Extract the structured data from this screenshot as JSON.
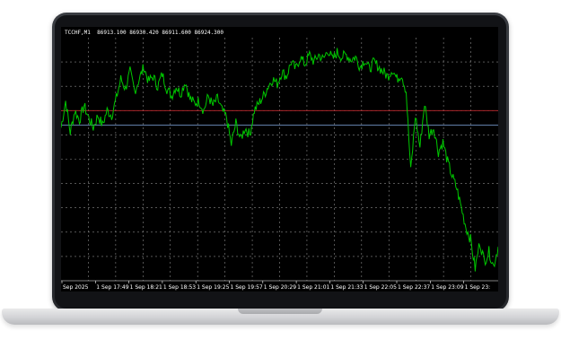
{
  "window": {
    "header": "TCCHF,M1  86913.100 86930.420 86911.600 86924.300"
  },
  "chart_data": {
    "type": "line",
    "symbol": "TCCHF,M1",
    "ohlc": {
      "open": 86913.1,
      "high": 86930.42,
      "low": 86911.6,
      "close": 86924.3
    },
    "background": "#000000",
    "line_color": "#00c800",
    "grid": true,
    "grid_color": "#8a8a8a",
    "bid_line_color": "#c0282d",
    "ask_line_color": "#6f8fbf",
    "x_tick_labels": [
      "Sep 2025",
      "1 Sep 17:49",
      "1 Sep 18:21",
      "1 Sep 18:53",
      "1 Sep 19:25",
      "1 Sep 19:57",
      "1 Sep 20:29",
      "1 Sep 21:01",
      "1 Sep 21:33",
      "1 Sep 22:05",
      "1 Sep 22:37",
      "1 Sep 23:09",
      "1 Sep 23:"
    ],
    "y": {
      "min": 0,
      "max": 100
    },
    "bid_level": 70,
    "ask_level": 64,
    "points": [
      [
        0,
        63
      ],
      [
        1,
        74
      ],
      [
        2,
        61
      ],
      [
        3,
        70
      ],
      [
        4,
        66
      ],
      [
        5,
        72
      ],
      [
        6,
        67
      ],
      [
        7,
        63
      ],
      [
        8,
        68
      ],
      [
        9,
        64
      ],
      [
        10,
        70
      ],
      [
        11,
        68
      ],
      [
        12,
        75
      ],
      [
        13,
        83
      ],
      [
        14,
        79
      ],
      [
        15,
        86
      ],
      [
        16,
        78
      ],
      [
        17,
        83
      ],
      [
        18,
        88
      ],
      [
        19,
        82
      ],
      [
        20,
        84
      ],
      [
        21,
        80
      ],
      [
        22,
        85
      ],
      [
        23,
        79
      ],
      [
        24,
        76
      ],
      [
        25,
        80
      ],
      [
        26,
        77
      ],
      [
        27,
        82
      ],
      [
        28,
        75
      ],
      [
        29,
        73
      ],
      [
        30,
        74
      ],
      [
        31,
        70
      ],
      [
        32,
        76
      ],
      [
        33,
        72
      ],
      [
        34,
        75
      ],
      [
        35,
        70
      ],
      [
        36,
        67
      ],
      [
        37,
        56
      ],
      [
        38,
        65
      ],
      [
        39,
        58
      ],
      [
        40,
        63
      ],
      [
        41,
        60
      ],
      [
        42,
        70
      ],
      [
        43,
        73
      ],
      [
        44,
        76
      ],
      [
        45,
        80
      ],
      [
        46,
        83
      ],
      [
        47,
        81
      ],
      [
        48,
        86
      ],
      [
        49,
        84
      ],
      [
        50,
        90
      ],
      [
        51,
        87
      ],
      [
        52,
        92
      ],
      [
        53,
        89
      ],
      [
        54,
        93
      ],
      [
        55,
        90
      ],
      [
        56,
        93
      ],
      [
        57,
        91
      ],
      [
        58,
        95
      ],
      [
        59,
        91
      ],
      [
        60,
        94
      ],
      [
        61,
        92
      ],
      [
        62,
        93
      ],
      [
        63,
        91
      ],
      [
        64,
        92
      ],
      [
        65,
        88
      ],
      [
        66,
        91
      ],
      [
        67,
        87
      ],
      [
        68,
        90
      ],
      [
        69,
        88
      ],
      [
        70,
        86
      ],
      [
        71,
        84
      ],
      [
        72,
        87
      ],
      [
        73,
        83
      ],
      [
        74,
        85
      ],
      [
        75,
        78
      ],
      [
        76,
        45
      ],
      [
        77,
        68
      ],
      [
        78,
        55
      ],
      [
        79,
        73
      ],
      [
        80,
        60
      ],
      [
        81,
        63
      ],
      [
        82,
        53
      ],
      [
        83,
        57
      ],
      [
        84,
        49
      ],
      [
        85,
        43
      ],
      [
        86,
        38
      ],
      [
        87,
        30
      ],
      [
        88,
        22
      ],
      [
        89,
        17
      ],
      [
        90,
        5
      ],
      [
        91,
        16
      ],
      [
        92,
        8
      ],
      [
        93,
        12
      ],
      [
        94,
        6
      ],
      [
        95,
        14
      ]
    ]
  }
}
